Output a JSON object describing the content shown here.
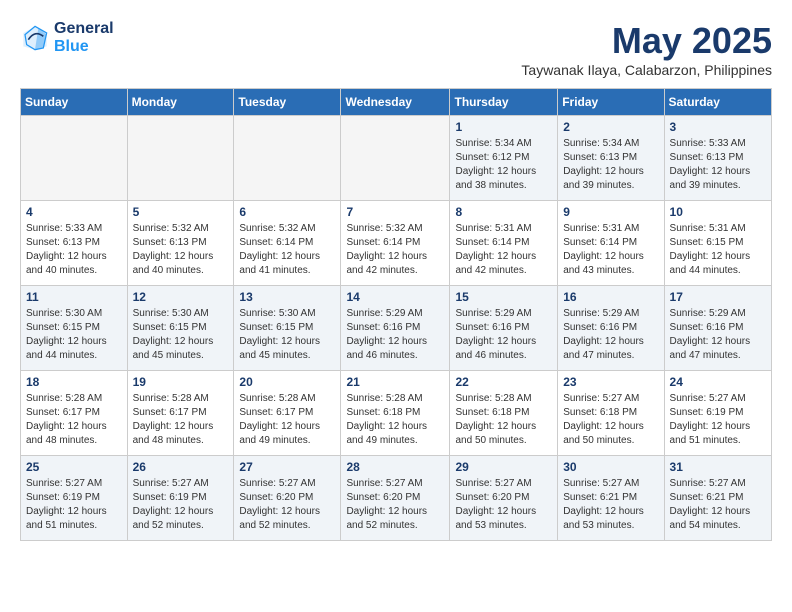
{
  "logo": {
    "line1": "General",
    "line2": "Blue"
  },
  "header": {
    "month": "May 2025",
    "location": "Taywanak Ilaya, Calabarzon, Philippines"
  },
  "weekdays": [
    "Sunday",
    "Monday",
    "Tuesday",
    "Wednesday",
    "Thursday",
    "Friday",
    "Saturday"
  ],
  "weeks": [
    [
      {
        "day": "",
        "info": ""
      },
      {
        "day": "",
        "info": ""
      },
      {
        "day": "",
        "info": ""
      },
      {
        "day": "",
        "info": ""
      },
      {
        "day": "1",
        "info": "Sunrise: 5:34 AM\nSunset: 6:12 PM\nDaylight: 12 hours\nand 38 minutes."
      },
      {
        "day": "2",
        "info": "Sunrise: 5:34 AM\nSunset: 6:13 PM\nDaylight: 12 hours\nand 39 minutes."
      },
      {
        "day": "3",
        "info": "Sunrise: 5:33 AM\nSunset: 6:13 PM\nDaylight: 12 hours\nand 39 minutes."
      }
    ],
    [
      {
        "day": "4",
        "info": "Sunrise: 5:33 AM\nSunset: 6:13 PM\nDaylight: 12 hours\nand 40 minutes."
      },
      {
        "day": "5",
        "info": "Sunrise: 5:32 AM\nSunset: 6:13 PM\nDaylight: 12 hours\nand 40 minutes."
      },
      {
        "day": "6",
        "info": "Sunrise: 5:32 AM\nSunset: 6:14 PM\nDaylight: 12 hours\nand 41 minutes."
      },
      {
        "day": "7",
        "info": "Sunrise: 5:32 AM\nSunset: 6:14 PM\nDaylight: 12 hours\nand 42 minutes."
      },
      {
        "day": "8",
        "info": "Sunrise: 5:31 AM\nSunset: 6:14 PM\nDaylight: 12 hours\nand 42 minutes."
      },
      {
        "day": "9",
        "info": "Sunrise: 5:31 AM\nSunset: 6:14 PM\nDaylight: 12 hours\nand 43 minutes."
      },
      {
        "day": "10",
        "info": "Sunrise: 5:31 AM\nSunset: 6:15 PM\nDaylight: 12 hours\nand 44 minutes."
      }
    ],
    [
      {
        "day": "11",
        "info": "Sunrise: 5:30 AM\nSunset: 6:15 PM\nDaylight: 12 hours\nand 44 minutes."
      },
      {
        "day": "12",
        "info": "Sunrise: 5:30 AM\nSunset: 6:15 PM\nDaylight: 12 hours\nand 45 minutes."
      },
      {
        "day": "13",
        "info": "Sunrise: 5:30 AM\nSunset: 6:15 PM\nDaylight: 12 hours\nand 45 minutes."
      },
      {
        "day": "14",
        "info": "Sunrise: 5:29 AM\nSunset: 6:16 PM\nDaylight: 12 hours\nand 46 minutes."
      },
      {
        "day": "15",
        "info": "Sunrise: 5:29 AM\nSunset: 6:16 PM\nDaylight: 12 hours\nand 46 minutes."
      },
      {
        "day": "16",
        "info": "Sunrise: 5:29 AM\nSunset: 6:16 PM\nDaylight: 12 hours\nand 47 minutes."
      },
      {
        "day": "17",
        "info": "Sunrise: 5:29 AM\nSunset: 6:16 PM\nDaylight: 12 hours\nand 47 minutes."
      }
    ],
    [
      {
        "day": "18",
        "info": "Sunrise: 5:28 AM\nSunset: 6:17 PM\nDaylight: 12 hours\nand 48 minutes."
      },
      {
        "day": "19",
        "info": "Sunrise: 5:28 AM\nSunset: 6:17 PM\nDaylight: 12 hours\nand 48 minutes."
      },
      {
        "day": "20",
        "info": "Sunrise: 5:28 AM\nSunset: 6:17 PM\nDaylight: 12 hours\nand 49 minutes."
      },
      {
        "day": "21",
        "info": "Sunrise: 5:28 AM\nSunset: 6:18 PM\nDaylight: 12 hours\nand 49 minutes."
      },
      {
        "day": "22",
        "info": "Sunrise: 5:28 AM\nSunset: 6:18 PM\nDaylight: 12 hours\nand 50 minutes."
      },
      {
        "day": "23",
        "info": "Sunrise: 5:27 AM\nSunset: 6:18 PM\nDaylight: 12 hours\nand 50 minutes."
      },
      {
        "day": "24",
        "info": "Sunrise: 5:27 AM\nSunset: 6:19 PM\nDaylight: 12 hours\nand 51 minutes."
      }
    ],
    [
      {
        "day": "25",
        "info": "Sunrise: 5:27 AM\nSunset: 6:19 PM\nDaylight: 12 hours\nand 51 minutes."
      },
      {
        "day": "26",
        "info": "Sunrise: 5:27 AM\nSunset: 6:19 PM\nDaylight: 12 hours\nand 52 minutes."
      },
      {
        "day": "27",
        "info": "Sunrise: 5:27 AM\nSunset: 6:20 PM\nDaylight: 12 hours\nand 52 minutes."
      },
      {
        "day": "28",
        "info": "Sunrise: 5:27 AM\nSunset: 6:20 PM\nDaylight: 12 hours\nand 52 minutes."
      },
      {
        "day": "29",
        "info": "Sunrise: 5:27 AM\nSunset: 6:20 PM\nDaylight: 12 hours\nand 53 minutes."
      },
      {
        "day": "30",
        "info": "Sunrise: 5:27 AM\nSunset: 6:21 PM\nDaylight: 12 hours\nand 53 minutes."
      },
      {
        "day": "31",
        "info": "Sunrise: 5:27 AM\nSunset: 6:21 PM\nDaylight: 12 hours\nand 54 minutes."
      }
    ]
  ]
}
